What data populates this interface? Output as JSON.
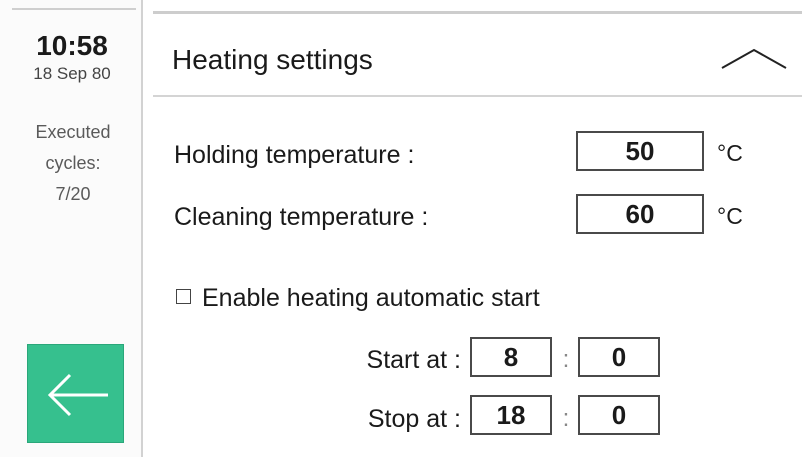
{
  "status": {
    "time": "10:58",
    "date": "18 Sep 80",
    "cycles_label": "Executed cycles:",
    "cycles_value": "7/20"
  },
  "navigation": {
    "back_icon": "arrow-left-icon",
    "back_color": "#36c08e"
  },
  "panel": {
    "title": "Heating settings",
    "toggle_icon": "chevron-up-icon",
    "holding": {
      "label": "Holding temperature :",
      "value": "50",
      "unit": "°C"
    },
    "cleaning": {
      "label": "Cleaning temperature :",
      "value": "60",
      "unit": "°C"
    },
    "auto_start": {
      "label": "Enable heating automatic start",
      "checked": false
    },
    "start": {
      "label": "Start at :",
      "hour": "8",
      "minute": "0"
    },
    "stop": {
      "label": "Stop at :",
      "hour": "18",
      "minute": "0"
    },
    "time_separator": ":"
  }
}
